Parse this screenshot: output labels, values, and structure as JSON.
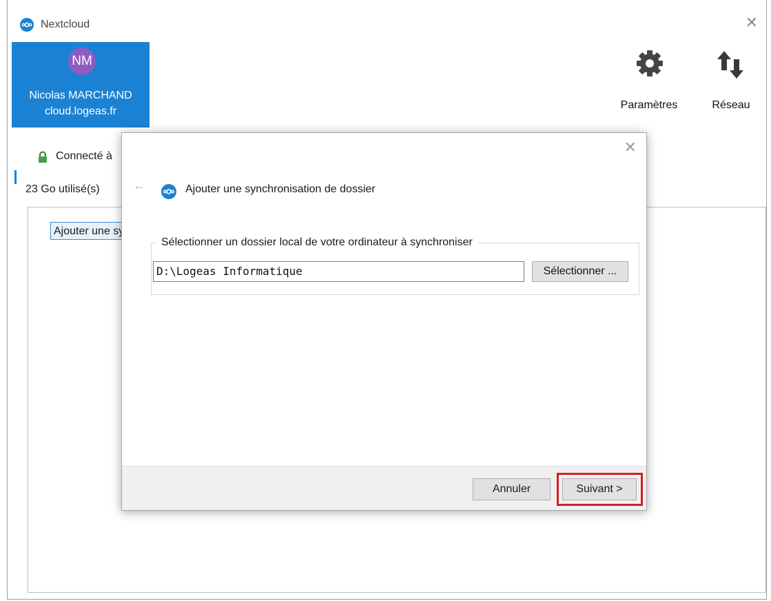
{
  "window": {
    "title": "Nextcloud",
    "close_glyph": "✕"
  },
  "account": {
    "initials": "NM",
    "name": "Nicolas MARCHAND",
    "server": "cloud.logeas.fr",
    "avatar_color": "#8c5cc2",
    "card_color": "#1b82d3"
  },
  "toolbar": {
    "settings_label": "Paramètres",
    "settings_icon": "gear-icon",
    "network_label": "Réseau",
    "network_icon": "up-down-arrows-icon"
  },
  "status": {
    "connected_text": "Connecté à",
    "lock_icon": "lock-icon",
    "quota": "23 Go utilisé(s)"
  },
  "folders": {
    "add_button_label": "Ajouter une synchronisation de dossier"
  },
  "dialog": {
    "close_glyph": "✕",
    "back_glyph": "←",
    "title": "Ajouter une synchronisation de dossier",
    "group_label": "Sélectionner un dossier local de votre ordinateur à synchroniser",
    "path_value": "D:\\Logeas Informatique",
    "select_button": "Sélectionner ...",
    "cancel_button": "Annuler",
    "next_button": "Suivant >",
    "highlight_color": "#d41e28"
  }
}
